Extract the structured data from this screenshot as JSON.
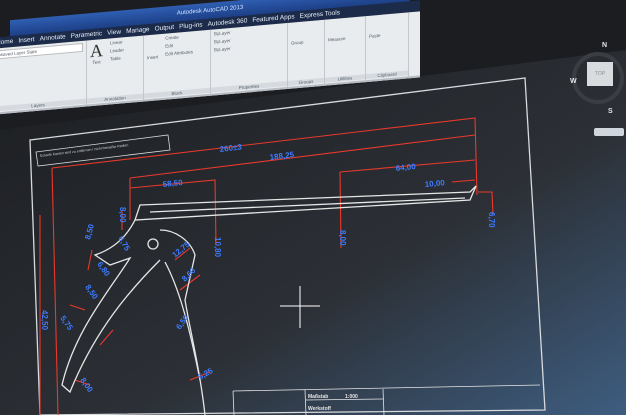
{
  "window": {
    "title": "Autodesk AutoCAD 2013"
  },
  "ribbon": {
    "tabs": [
      "Home",
      "Insert",
      "Annotate",
      "Parametric",
      "View",
      "Manage",
      "Output",
      "Plug-ins",
      "Autodesk 360",
      "Featured Apps",
      "Express Tools"
    ],
    "panels": {
      "layers": {
        "label": "Layers",
        "layer_value": "Unsaved Layer State"
      },
      "annotation": {
        "label": "Annotation",
        "text": "Text",
        "linear": "Linear",
        "leader": "Leader",
        "table": "Table"
      },
      "block": {
        "label": "Block",
        "insert": "Insert",
        "create": "Create",
        "edit": "Edit",
        "edit_attributes": "Edit Attributes"
      },
      "properties": {
        "label": "Properties",
        "color": "ByLayer",
        "linetype": "ByLayer",
        "lineweight": "ByLayer"
      },
      "groups": {
        "label": "Groups",
        "group": "Group"
      },
      "utilities": {
        "label": "Utilities",
        "measure": "Measure"
      },
      "clipboard": {
        "label": "Clipboard",
        "paste": "Paste"
      }
    }
  },
  "viewcube": {
    "north": "N",
    "west": "W",
    "south": "S",
    "face": "TOP"
  },
  "drawing": {
    "note": "Scharfe Kanten sind zu entfernen / nicht bemaßte Radien",
    "dimensions": {
      "overall": "260±3",
      "d188": "188,25",
      "d58": "58,50",
      "d64": "64,00",
      "d10": "10,00",
      "v670": "6,70",
      "v800": "8,00",
      "v1080": "10,80",
      "v800b": "8,00",
      "r1275": "12,75",
      "r860": "8,60",
      "a1": "8,50",
      "a2": "6,75",
      "a3": "6,80",
      "a4": "8,50",
      "a5": "5,75",
      "a6": "8,00",
      "a7": "6,50",
      "a8": "5,25",
      "a9": "42,50"
    },
    "title_block": {
      "scale_label": "Maßstab",
      "scale_value": "1:000",
      "material_label": "Werkstoff"
    }
  },
  "colors": {
    "dimension_line": "#e8392c",
    "dimension_text": "#3d7bff",
    "geometry": "#e6e6e6",
    "background": "#1e2024"
  }
}
